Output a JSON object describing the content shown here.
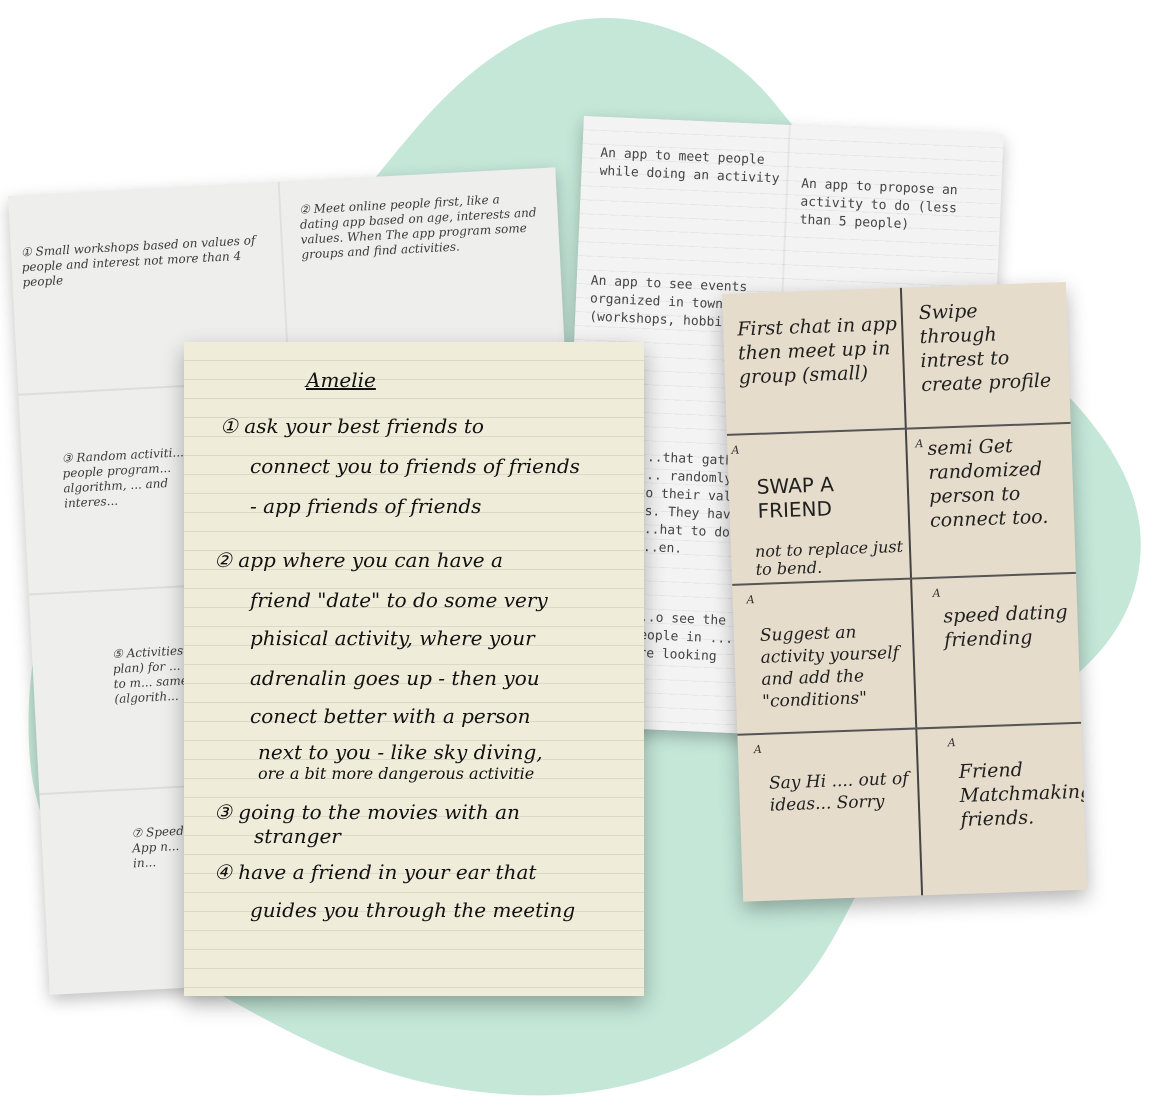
{
  "left_sheet": {
    "notes": [
      "① Small workshops based on values of people and interest not more than 4 people",
      "② Meet online people first, like a dating app based on age, interests and values. When The app program some groups and find activities.",
      "③ Random activiti... people program... algorithm, ... and interes...",
      "⑤ Activities ... plan) for ... order to m... same in... (algorith...",
      "⑦ Speed ... app. App n... peo... in..."
    ]
  },
  "mid_sheet": {
    "notes": [
      "An app to meet people while doing an activity",
      "An app to propose an activity to do (less than 5 people)",
      "An app to see events organized in town (workshops, hobbie...",
      "...that gather ... randomly ... to their val... ts. They have ...hat to do ...en.",
      "...o see the ... people in ... are looking"
    ]
  },
  "center_sheet": {
    "title": "Amelie",
    "lines": [
      "① ask your best friends to",
      "connect you to friends of friends",
      "- app friends of friends",
      "② app where you can have a",
      "friend \"date\" to do some very",
      "phisical activity, where your",
      "adrenalin goes up - then you",
      "conect better with a person",
      "next to you - like sky diving,",
      "ore a bit more dangerous activitie",
      "③ going to the movies with an",
      "stranger",
      "④ have a friend in your ear that",
      "guides you through the meeting"
    ]
  },
  "right_sheet": {
    "cells": [
      "First chat in app then meet up in group (small)",
      "Swipe through intrest to create profile",
      "SWAP A FRIEND",
      "semi Get randomized person to connect too.",
      "not to replace just to bend.",
      "Suggest an activity yourself and add the \"conditions\"",
      "speed dating friending",
      "Say Hi .... out of ideas... Sorry",
      "Friend Matchmaking friends."
    ],
    "corner_mark": "A"
  }
}
